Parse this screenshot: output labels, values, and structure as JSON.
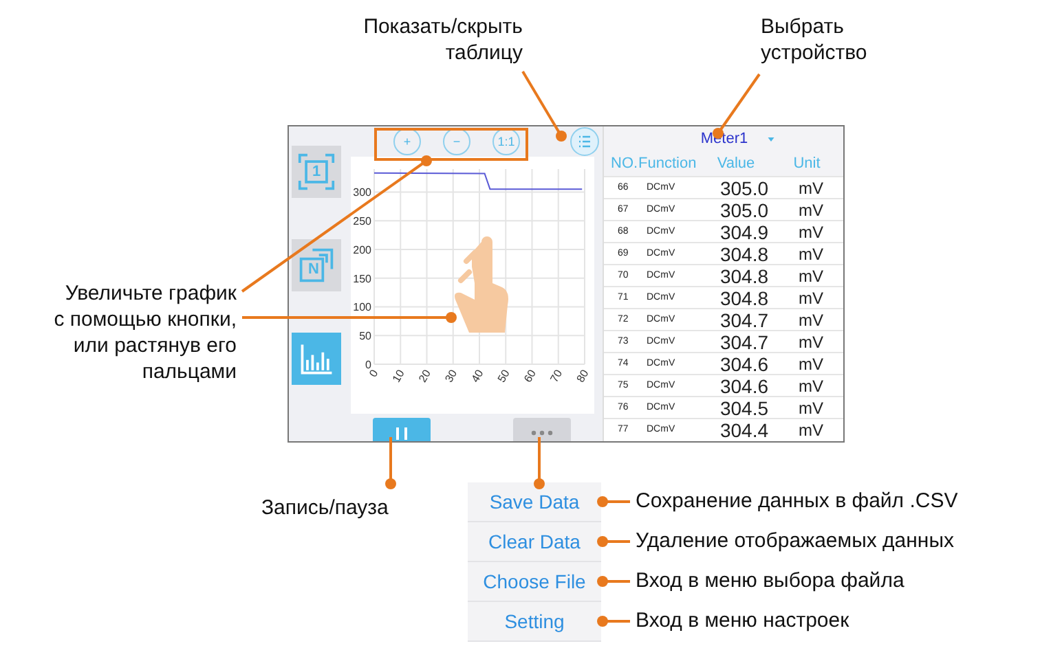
{
  "screen": {
    "sidebar": [
      {
        "kind": "fit",
        "label": "1",
        "selected": false
      },
      {
        "kind": "newest",
        "label": "N",
        "selected": false
      },
      {
        "kind": "chart",
        "selected": true
      }
    ],
    "zoom_buttons": [
      "+",
      "−",
      "1:1"
    ],
    "chart_data": {
      "type": "line",
      "grid": true,
      "xlim": [
        0,
        80
      ],
      "ylim": [
        0,
        340
      ],
      "xticks": [
        0,
        10,
        20,
        30,
        40,
        50,
        60,
        70,
        80
      ],
      "yticks": [
        0,
        50,
        100,
        150,
        200,
        250,
        300
      ],
      "x": [
        0,
        42,
        44,
        79
      ],
      "series": [
        {
          "color": "#5a5ad6",
          "values": [
            333,
            332,
            305,
            305
          ]
        }
      ]
    },
    "device": "Meter1",
    "table": {
      "columns": [
        "NO.",
        "Function",
        "Value",
        "Unit"
      ],
      "rows": [
        [
          "66",
          "DCmV",
          "305.0",
          "mV"
        ],
        [
          "67",
          "DCmV",
          "305.0",
          "mV"
        ],
        [
          "68",
          "DCmV",
          "304.9",
          "mV"
        ],
        [
          "69",
          "DCmV",
          "304.8",
          "mV"
        ],
        [
          "70",
          "DCmV",
          "304.8",
          "mV"
        ],
        [
          "71",
          "DCmV",
          "304.8",
          "mV"
        ],
        [
          "72",
          "DCmV",
          "304.7",
          "mV"
        ],
        [
          "73",
          "DCmV",
          "304.7",
          "mV"
        ],
        [
          "74",
          "DCmV",
          "304.6",
          "mV"
        ],
        [
          "75",
          "DCmV",
          "304.6",
          "mV"
        ],
        [
          "76",
          "DCmV",
          "304.5",
          "mV"
        ],
        [
          "77",
          "DCmV",
          "304.4",
          "mV"
        ]
      ]
    }
  },
  "menu": [
    "Save Data",
    "Clear Data",
    "Choose File",
    "Setting"
  ],
  "callouts": [
    "Показать/скрыть\nтаблицу",
    "Выбрать\nустройство",
    "Увеличьте график\nс помощью кнопки,\nили растянув его\nпальцами",
    "Запись/пауза",
    "Сохранение данных в файл .CSV",
    "Удаление отображаемых данных",
    "Вход в меню выбора файла",
    "Вход в меню настроек"
  ]
}
